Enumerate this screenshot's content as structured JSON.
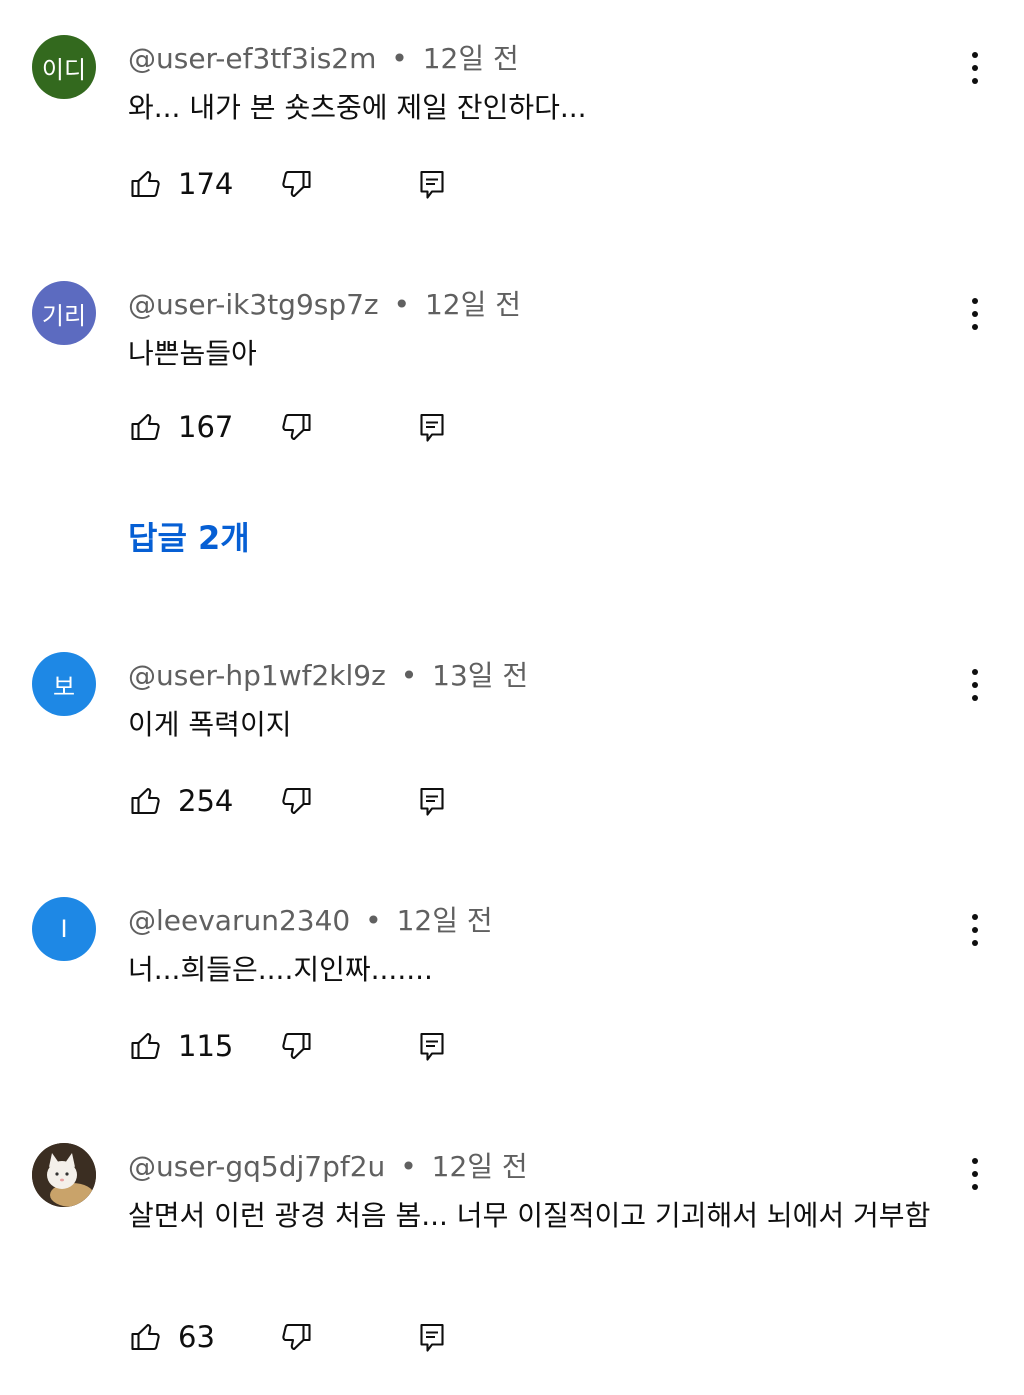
{
  "comments": [
    {
      "avatar_text": "이디",
      "avatar_color": "#33691e",
      "handle": "@user-ef3tf3is2m",
      "time": "12일 전",
      "text": "와... 내가 본 숏츠중에 제일 잔인하다...",
      "likes": "174"
    },
    {
      "avatar_text": "기리",
      "avatar_color": "#5c6bc0",
      "handle": "@user-ik3tg9sp7z",
      "time": "12일 전",
      "text": "나쁜놈들아",
      "likes": "167"
    },
    {
      "avatar_text": "보",
      "avatar_color": "#1e88e5",
      "handle": "@user-hp1wf2kl9z",
      "time": "13일 전",
      "text": "이게 폭력이지",
      "likes": "254"
    },
    {
      "avatar_text": "I",
      "avatar_color": "#1e88e5",
      "handle": "@leevarun2340",
      "time": "12일 전",
      "text": "너...희들은....지인짜.......",
      "likes": "115"
    },
    {
      "avatar_text": "",
      "avatar_color": "#4a3a2a",
      "handle": "@user-gq5dj7pf2u",
      "time": "12일 전",
      "text": "살면서 이런 광경 처음 봄... 너무 이질적이고 기괴해서 뇌에서 거부함",
      "likes": "63"
    }
  ],
  "replies_link": "답글 2개",
  "separator": "•",
  "icons": {
    "like": "thumbs-up-icon",
    "dislike": "thumbs-down-icon",
    "reply": "reply-icon",
    "more": "more-vertical-icon"
  }
}
